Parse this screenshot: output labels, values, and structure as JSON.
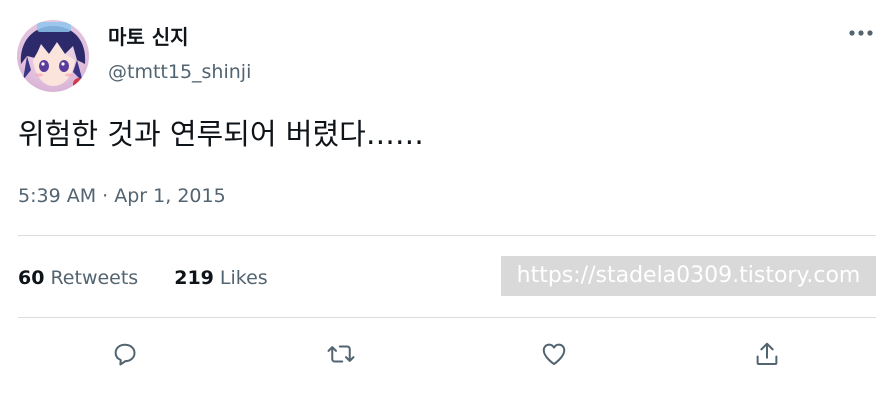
{
  "author": {
    "display_name": "마토 신지",
    "handle": "@tmtt15_shinji",
    "avatar_icon": "anime-character-avatar-icon"
  },
  "tweet": {
    "text": "위험한 것과 연루되어 버렸다……",
    "time": "5:39 AM",
    "separator": "·",
    "date": "Apr 1, 2015"
  },
  "stats": {
    "retweets_count": "60",
    "retweets_label": "Retweets",
    "likes_count": "219",
    "likes_label": "Likes"
  },
  "watermark": {
    "text": "https://stadela0309.tistory.com"
  },
  "actions": {
    "reply_icon": "reply-bubble-icon",
    "retweet_icon": "retweet-arrows-icon",
    "like_icon": "heart-icon",
    "share_icon": "share-upload-icon"
  },
  "colors": {
    "text_primary": "#0f1419",
    "text_secondary": "#536471",
    "divider": "#d7dde1",
    "watermark_bg": "#d9d9d9"
  }
}
